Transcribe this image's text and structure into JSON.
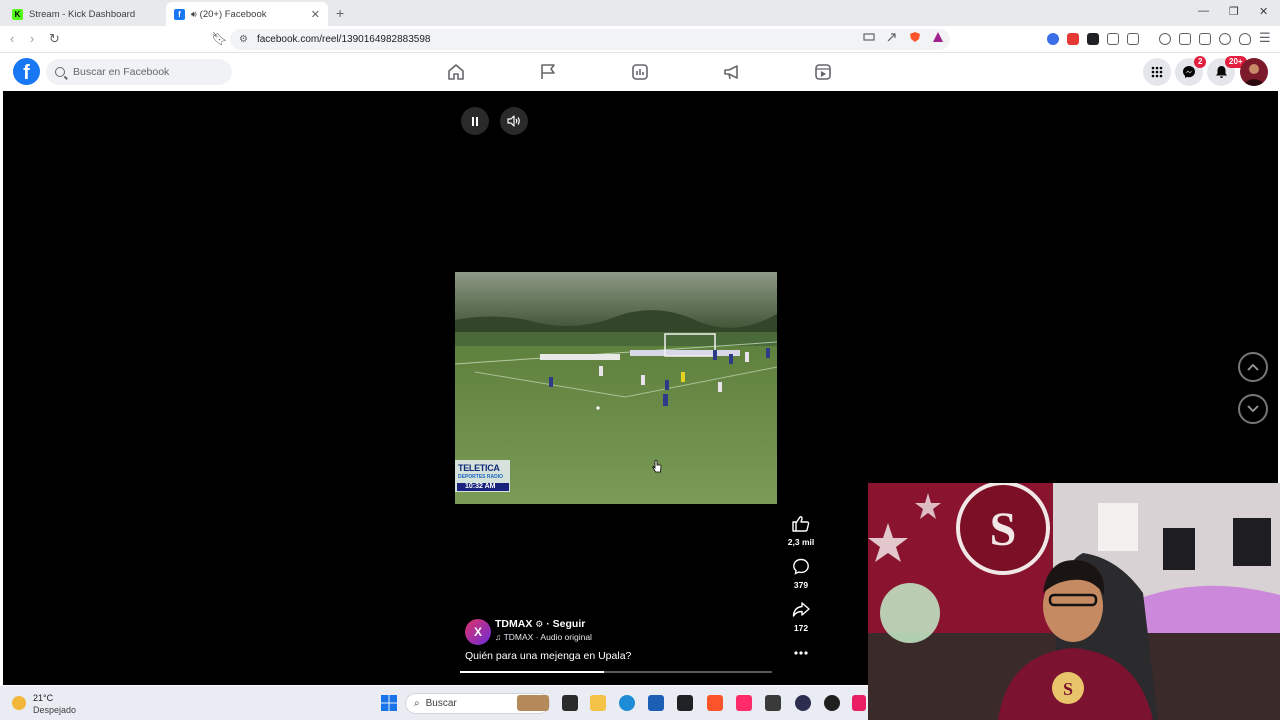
{
  "browser": {
    "tabs": [
      {
        "title": "Stream - Kick Dashboard",
        "active": false,
        "favicon": "kick-icon"
      },
      {
        "title": "(20+) Facebook",
        "active": true,
        "favicon": "facebook-icon",
        "audio": true
      }
    ],
    "url": "facebook.com/reel/1390164982883598"
  },
  "facebook": {
    "logo": "f",
    "search_placeholder": "Buscar en Facebook",
    "nav_icons": [
      "home-icon",
      "pages-flag-icon",
      "video-icon",
      "marketplace-megaphone-icon",
      "reels-icon"
    ],
    "messenger_badge": "2",
    "notifications_badge": "20+"
  },
  "reel": {
    "video_overlay": {
      "brand": "TELETICA",
      "sub_brand": "DEPORTES RADIO",
      "time": "10:32 AM"
    },
    "likes": "2,3 mil",
    "comments": "379",
    "shares": "172",
    "author": {
      "name": "TDMAX",
      "follow_label": "· Seguir",
      "audio": "TDMAX · Audio original",
      "avatar_text": "X"
    },
    "caption": "Quién para una mejenga en Upala?",
    "progress": 0.46
  },
  "taskbar": {
    "temperature": "21°C",
    "condition": "Despejado",
    "search_label": "Buscar"
  },
  "colors": {
    "facebook_blue": "#1877f2",
    "badge_red": "#e41e3f",
    "stage_black": "#000000"
  }
}
